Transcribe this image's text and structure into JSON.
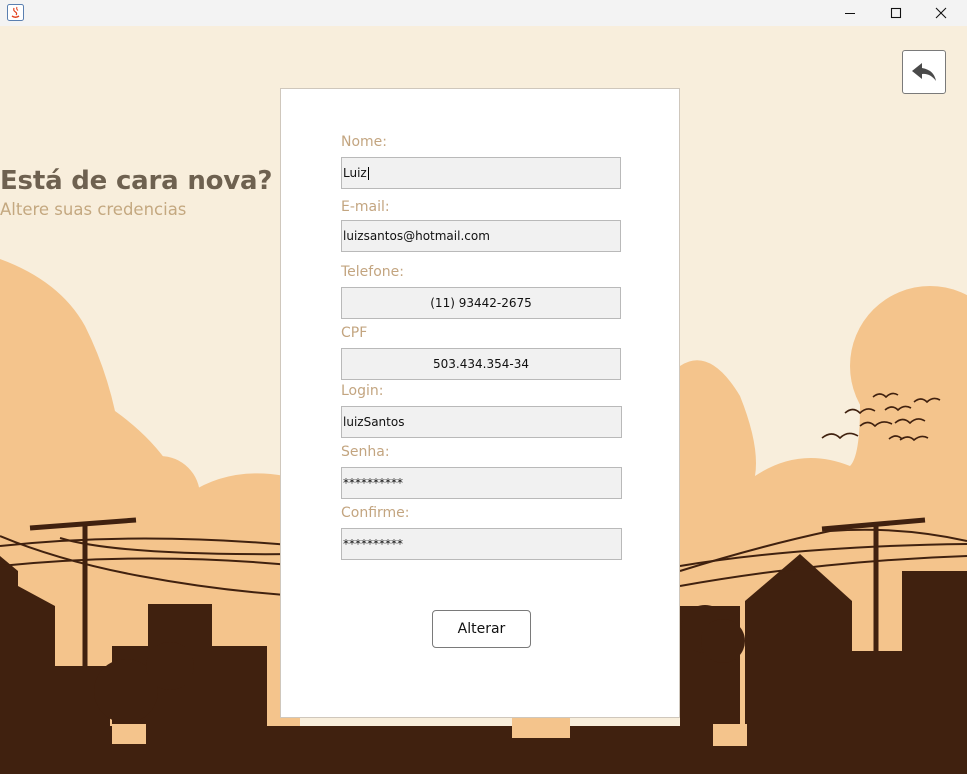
{
  "window": {
    "minimize_icon": "minimize-icon",
    "maximize_icon": "maximize-icon",
    "close_icon": "close-icon"
  },
  "header": {
    "title": "Está de cara nova?",
    "subtitle": "Altere suas credencias"
  },
  "back_button": {
    "icon": "back-arrow-icon"
  },
  "form": {
    "fields": [
      {
        "label": "Nome:",
        "value": "Luiz"
      },
      {
        "label": "E-mail:",
        "value": "luizsantos@hotmail.com"
      },
      {
        "label": "Telefone:",
        "value": "(11) 93442-2675"
      },
      {
        "label": "CPF",
        "value": "503.434.354-34"
      },
      {
        "label": "Login:",
        "value": "luizSantos"
      },
      {
        "label": "Senha:",
        "value": "**********"
      },
      {
        "label": "Confirme:",
        "value": "**********"
      }
    ],
    "submit_label": "Alterar"
  },
  "colors": {
    "background": "#f8eedc",
    "hills": "#f4c48c",
    "silhouette": "#40210f",
    "heading": "#6e6150",
    "label": "#c3a580"
  }
}
